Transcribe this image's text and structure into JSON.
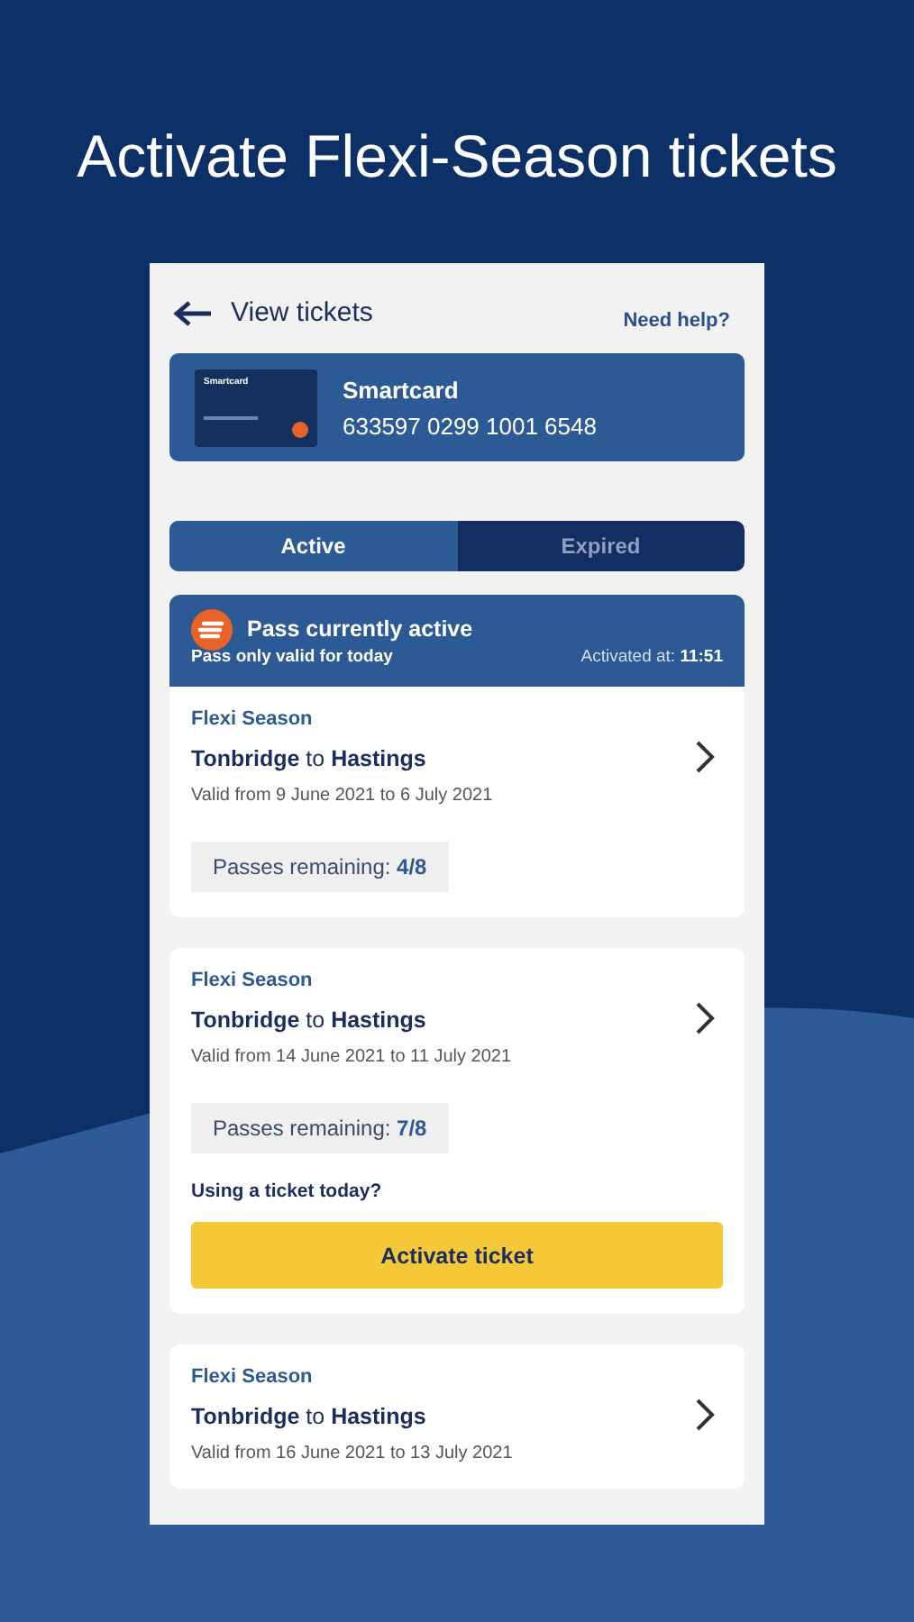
{
  "headline": "Activate Flexi-Season tickets",
  "header": {
    "back_label": "View tickets",
    "help_link": "Need help?"
  },
  "smartcard": {
    "thumbnail_label": "Smartcard",
    "name": "Smartcard",
    "number": "633597 0299 1001 6548"
  },
  "tabs": [
    {
      "label": "Active",
      "selected": true
    },
    {
      "label": "Expired",
      "selected": false
    }
  ],
  "active_banner": {
    "title": "Pass currently active",
    "subtitle": "Pass only valid for today",
    "activated_label": "Activated at:",
    "activated_time": "11:51"
  },
  "tickets": [
    {
      "type": "Flexi Season",
      "route": "**Tonbridge** to **Hastings**",
      "validity": "Valid from 9 June 2021 to 6 July 2021",
      "passes": "Passes remaining:  **4/8**",
      "active": true
    },
    {
      "type": "Flexi Season",
      "route": "**Tonbridge** to **Hastings**",
      "validity": "Valid from 14 June 2021 to 11 July 2021",
      "passes": "Passes remaining:  **7/8**",
      "active": false,
      "prompt": "Using a ticket today?",
      "action": "Activate ticket"
    },
    {
      "type": "Flexi Season",
      "route": "**Tonbridge** to **Hastings**",
      "validity": "Valid from 16 June 2021 to 13 July 2021",
      "active": false
    }
  ]
}
